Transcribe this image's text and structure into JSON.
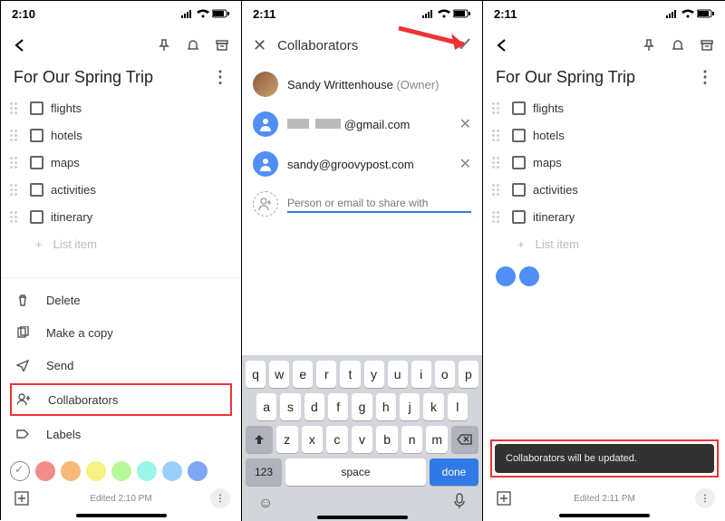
{
  "status": {
    "time1": "2:10",
    "time2": "2:11",
    "time3": "2:11"
  },
  "note": {
    "title": "For Our Spring Trip",
    "items": [
      "flights",
      "hotels",
      "maps",
      "activities",
      "itinerary"
    ],
    "placeholder": "List item",
    "edited1": "Edited 2:10 PM",
    "edited3": "Edited 2:11 PM"
  },
  "menu": {
    "delete": "Delete",
    "copy": "Make a copy",
    "send": "Send",
    "collab": "Collaborators",
    "labels": "Labels"
  },
  "colors": [
    "#ffffff",
    "#f08c8c",
    "#f7b878",
    "#f8f080",
    "#b8f89a",
    "#9af6e8",
    "#9ad0f8",
    "#7fa8f4"
  ],
  "collab": {
    "title": "Collaborators",
    "owner_name": "Sandy Writtenhouse",
    "owner_tag": "(Owner)",
    "email1_suffix": "@gmail.com",
    "email2": "sandy@groovypost.com",
    "placeholder": "Person or email to share with"
  },
  "kb": {
    "r1": [
      "q",
      "w",
      "e",
      "r",
      "t",
      "y",
      "u",
      "i",
      "o",
      "p"
    ],
    "r2": [
      "a",
      "s",
      "d",
      "f",
      "g",
      "h",
      "j",
      "k",
      "l"
    ],
    "r3": [
      "z",
      "x",
      "c",
      "v",
      "b",
      "n",
      "m"
    ],
    "n123": "123",
    "space": "space",
    "done": "done"
  },
  "toast": "Collaborators will be updated."
}
